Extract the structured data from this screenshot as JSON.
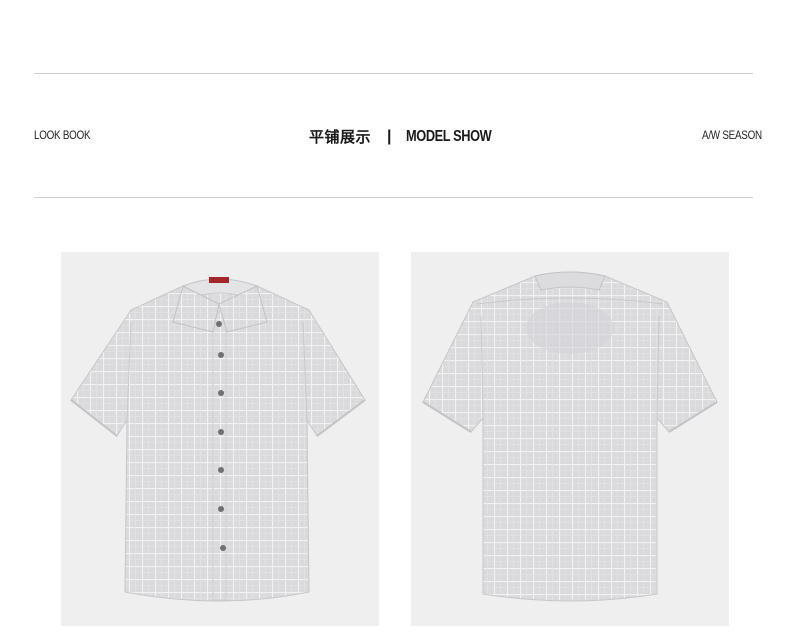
{
  "header": {
    "left_label": "LOOK BOOK",
    "title_cn": "平铺展示",
    "separator": "|",
    "title_en": "MODEL SHOW",
    "right_label": "A/W SEASON"
  },
  "products": [
    {
      "view": "front",
      "image_icon": "shirt-front-icon"
    },
    {
      "view": "back",
      "image_icon": "shirt-back-icon"
    }
  ],
  "colors": {
    "shirt": "#d9d9dc",
    "check_lines": "#f1f1f3",
    "panel_bg": "#efeff0",
    "rule": "#cfcfcf",
    "label_red": "#a3262b"
  }
}
